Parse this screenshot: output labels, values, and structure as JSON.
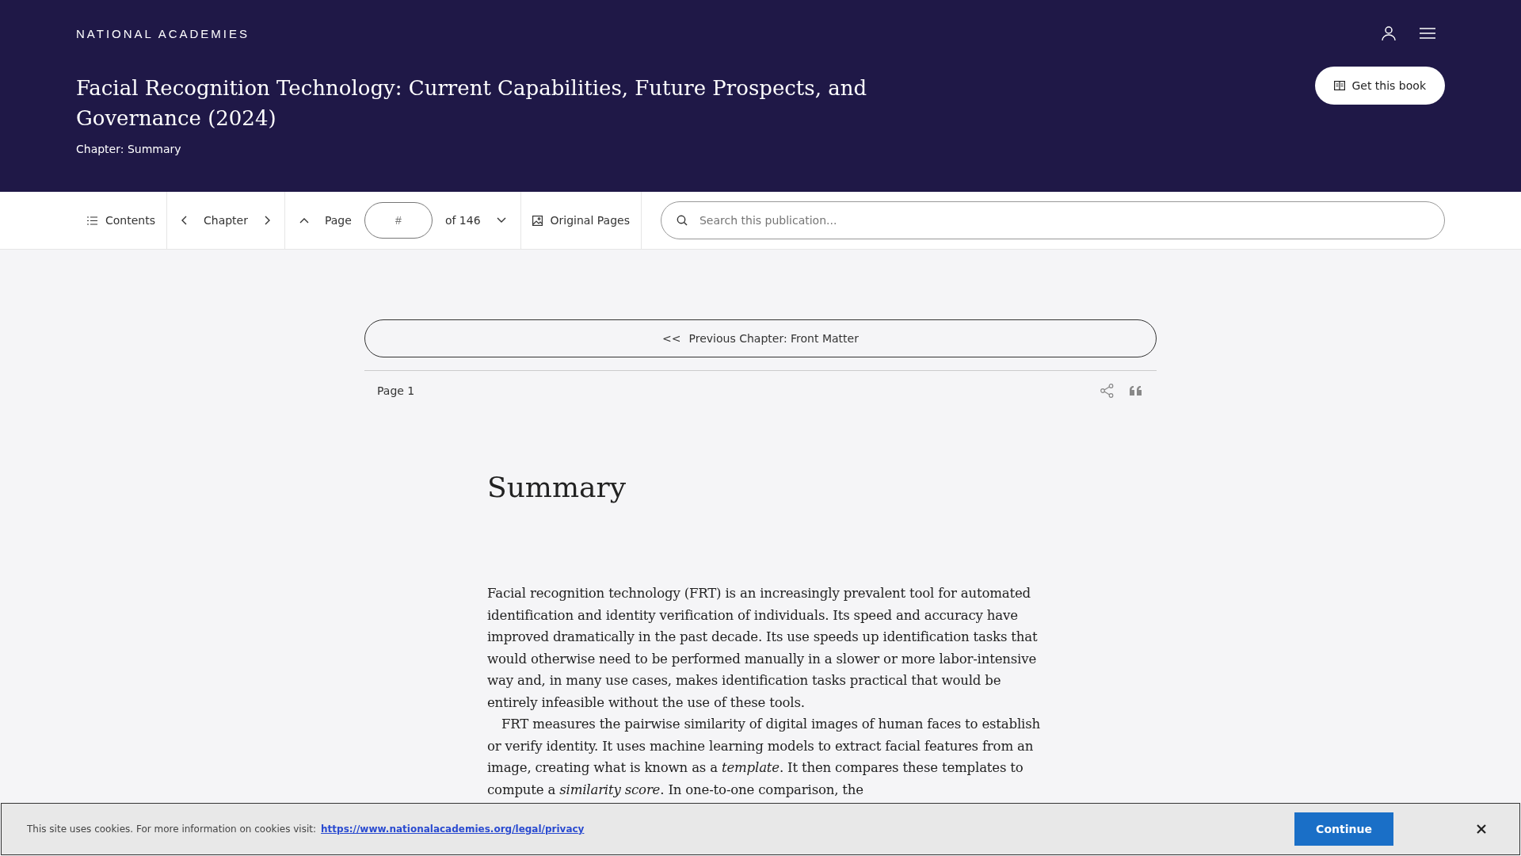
{
  "header": {
    "logo": "NATIONAL ACADEMIES",
    "title": "Facial Recognition Technology: Current Capabilities, Future Prospects, and Governance (2024)",
    "chapter": "Chapter: Summary",
    "get_book": "Get this book"
  },
  "toolbar": {
    "contents": "Contents",
    "chapter": "Chapter",
    "page_label": "Page",
    "page_placeholder": "#",
    "page_total": "of 146",
    "original_pages": "Original Pages",
    "search_placeholder": "Search this publication..."
  },
  "content": {
    "previous_chapter_arrows": "<<",
    "previous_chapter": "Previous Chapter: Front Matter",
    "page": "Page 1",
    "heading": "Summary",
    "paragraphs": [
      "Facial recognition technology (FRT) is an increasingly prevalent tool for automated identification and identity verification of individuals. Its speed and accuracy have improved dramatically in the past decade. Its use speeds up identification tasks that would otherwise need to be performed manually in a slower or more labor-intensive way and, in many use cases, makes identification tasks practical that would be entirely infeasible without the use of these tools.",
      "FRT measures the pairwise similarity of digital images of human faces to establish or verify identity. It uses machine learning models to extract facial features from an image, creating what is known as a *template*. It then compares these templates to compute a *similarity score*. In one-to-one comparison, the"
    ]
  },
  "cookie_banner": {
    "text": "This site uses cookies. For more information on cookies visit:",
    "link": "https://www.nationalacademies.org/legal/privacy",
    "button": "Continue"
  }
}
